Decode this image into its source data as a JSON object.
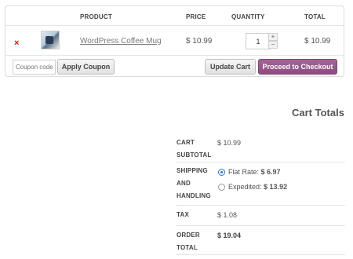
{
  "cart": {
    "headers": {
      "product": "PRODUCT",
      "price": "PRICE",
      "quantity": "QUANTITY",
      "total": "TOTAL"
    },
    "item": {
      "remove": "×",
      "name": "WordPress Coffee Mug",
      "price": "$ 10.99",
      "quantity": "1",
      "total": "$ 10.99"
    },
    "coupon_placeholder": "Coupon code",
    "apply_coupon": "Apply Coupon",
    "update_cart": "Update Cart",
    "checkout": "Proceed to Checkout",
    "qty_plus": "+",
    "qty_minus": "−"
  },
  "totals": {
    "title": "Cart Totals",
    "subtotal": {
      "label1": "CART",
      "label2": "SUBTOTAL",
      "value": "$ 10.99"
    },
    "shipping": {
      "label1": "SHIPPING",
      "label2": "AND",
      "label3": "HANDLING",
      "options": [
        {
          "name": "Flat Rate:",
          "amount": "$ 6.97",
          "selected": true
        },
        {
          "name": "Expedited:",
          "amount": "$ 13.92",
          "selected": false
        }
      ]
    },
    "tax": {
      "label": "TAX",
      "value": "$ 1.08"
    },
    "order": {
      "label1": "ORDER",
      "label2": "TOTAL",
      "value": "$ 19.04"
    }
  },
  "colors": {
    "remove": "#d31313",
    "checkout": "#8c4e81",
    "radio_selected": "#2a6fdb"
  }
}
